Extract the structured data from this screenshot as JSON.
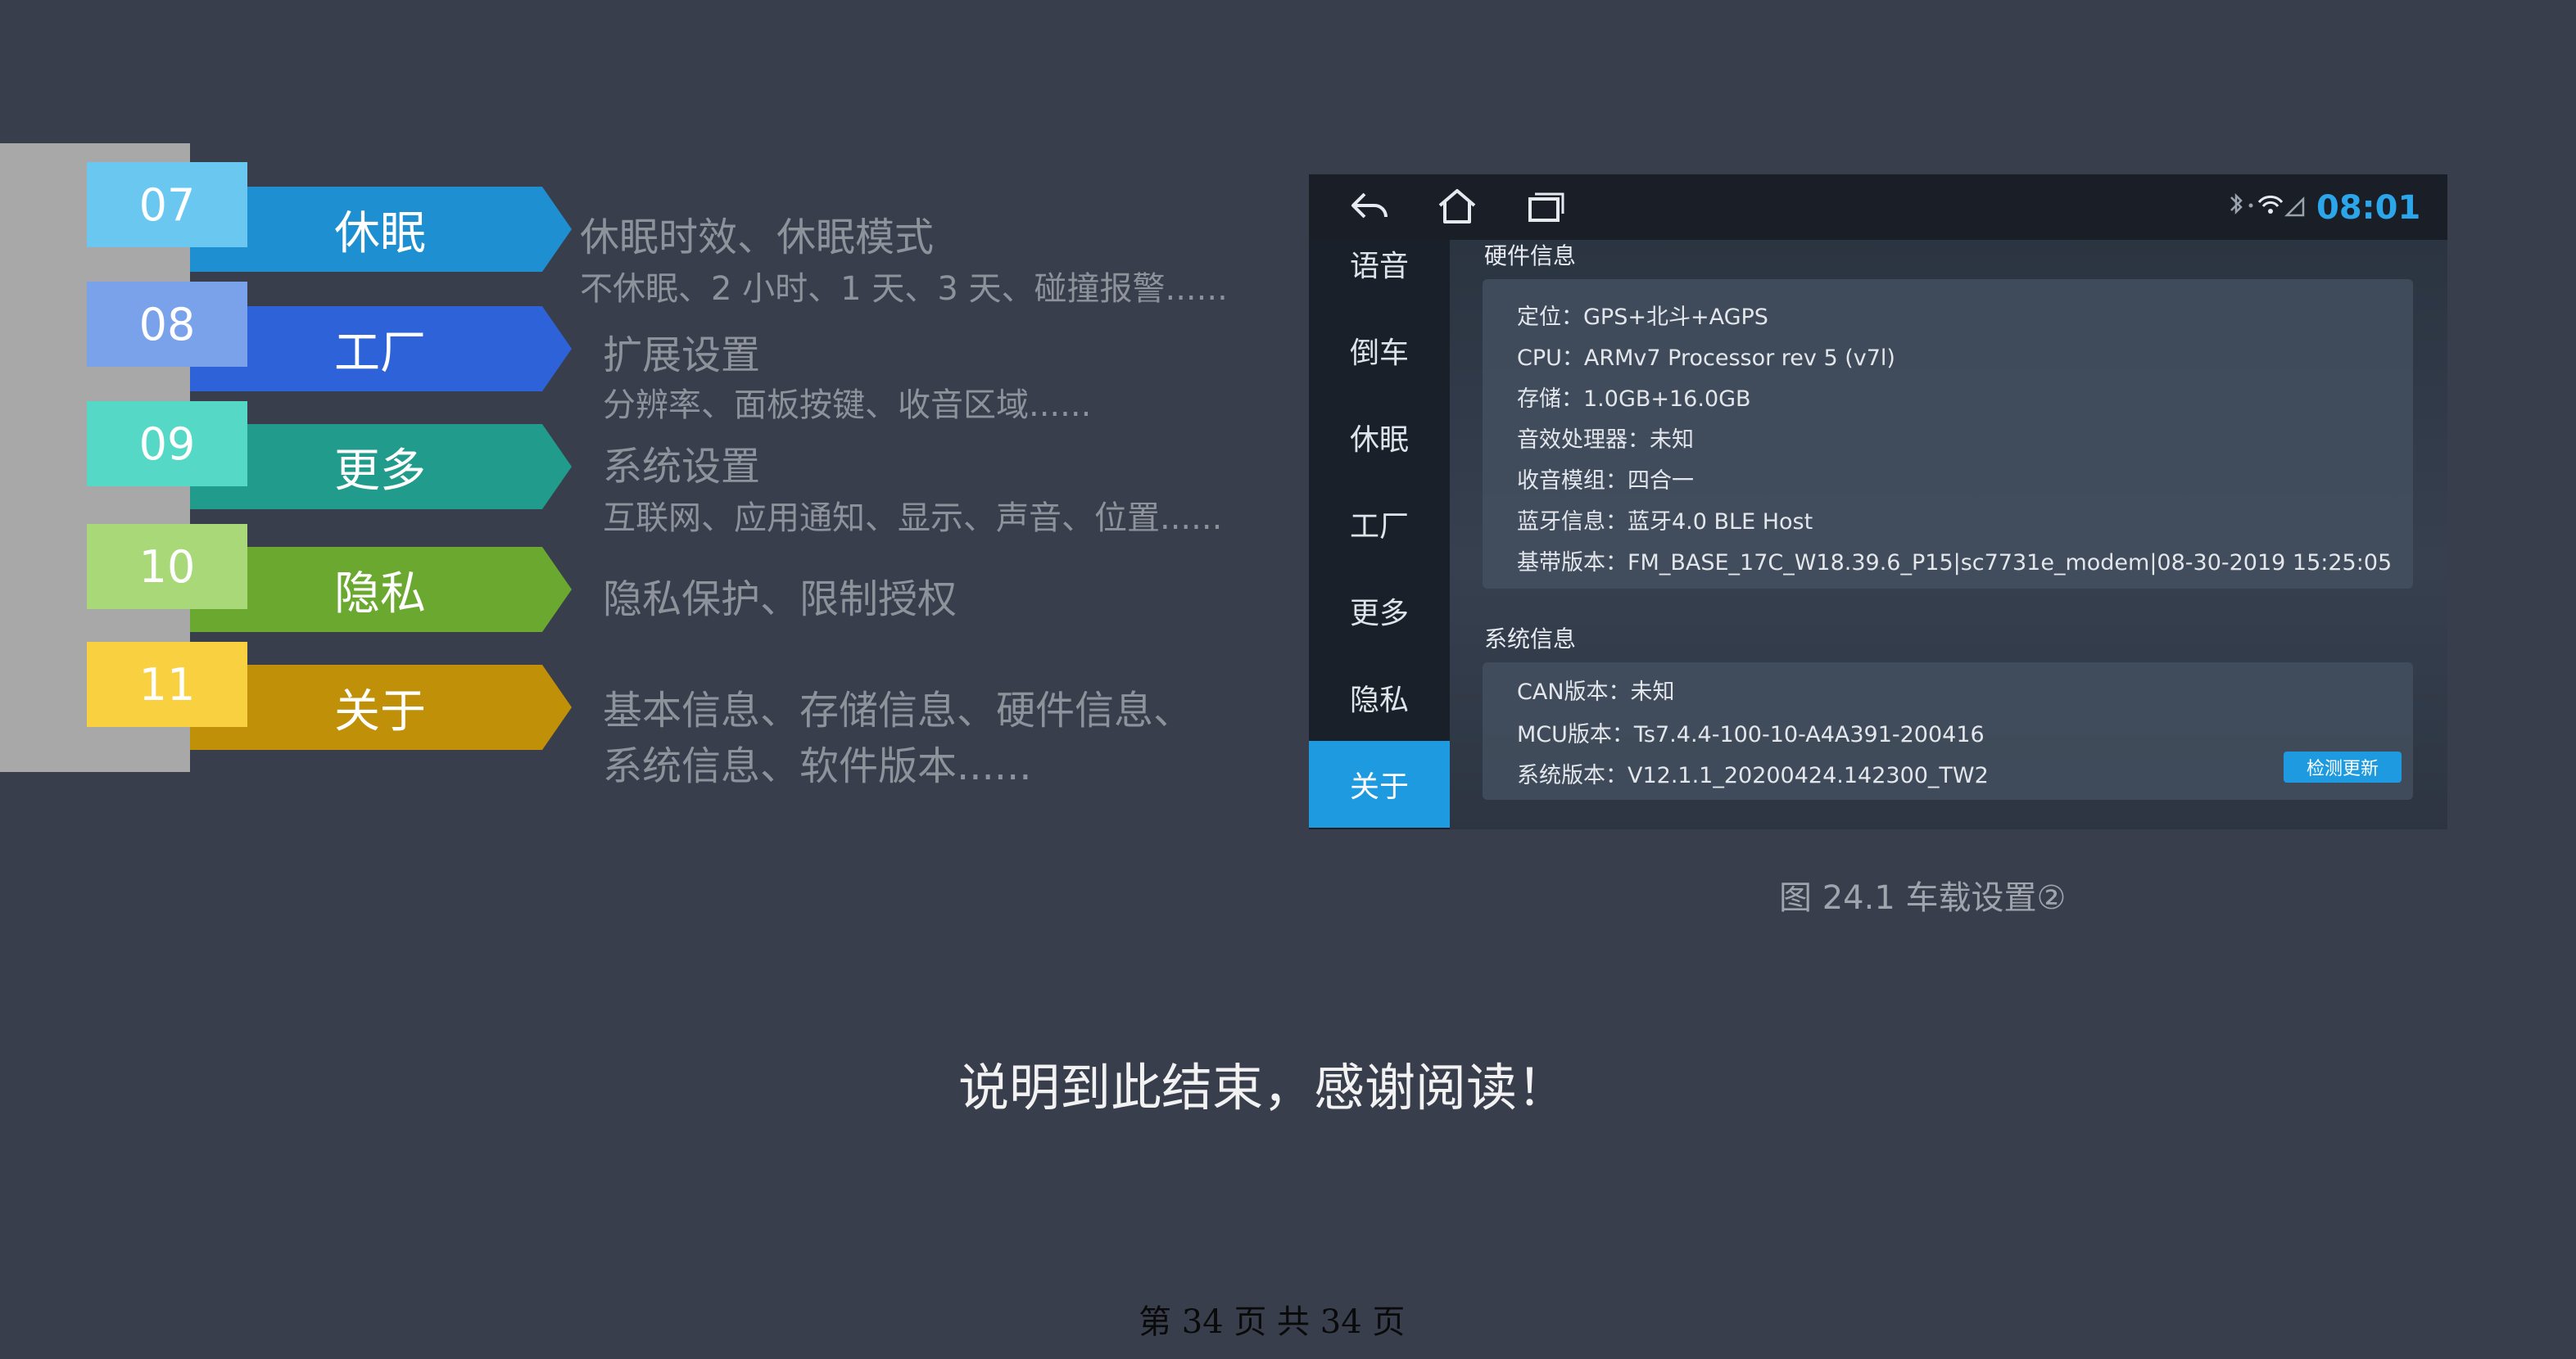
{
  "menu": [
    {
      "num": "07",
      "label": "休眠",
      "color_num": "#6ac8f0",
      "color_ribbon": "#1e8fd0",
      "title": "休眠时效、休眠模式",
      "sub": "不休眠、2 小时、1 天、3 天、碰撞报警......"
    },
    {
      "num": "08",
      "label": "工厂",
      "color_num": "#7aa2ea",
      "color_ribbon": "#2e62d8",
      "title": "扩展设置",
      "sub": "分辨率、面板按键、收音区域......"
    },
    {
      "num": "09",
      "label": "更多",
      "color_num": "#56d8c6",
      "color_ribbon": "#219b8c",
      "title": "系统设置",
      "sub": "互联网、应用通知、显示、声音、位置......"
    },
    {
      "num": "10",
      "label": "隐私",
      "color_num": "#a8d878",
      "color_ribbon": "#6aa830",
      "title": "隐私保护、限制授权",
      "sub": ""
    },
    {
      "num": "11",
      "label": "关于",
      "color_num": "#f8d040",
      "color_ribbon": "#c09008",
      "title": "基本信息、存储信息、硬件信息、",
      "sub": "系统信息、软件版本......"
    }
  ],
  "screen": {
    "time": "08:01",
    "sidebar": [
      "语音",
      "倒车",
      "休眠",
      "工厂",
      "更多",
      "隐私",
      "关于"
    ],
    "active_item": "关于",
    "hardware_title": "硬件信息",
    "hardware": [
      "定位：GPS+北斗+AGPS",
      "CPU：ARMv7 Processor rev 5 (v7l)",
      "存储：1.0GB+16.0GB",
      "音效处理器：未知",
      "收音模组：四合一",
      "蓝牙信息：蓝牙4.0 BLE Host",
      "基带版本：FM_BASE_17C_W18.39.6_P15|sc7731e_modem|08-30-2019 15:25:05"
    ],
    "system_title": "系统信息",
    "system": [
      "CAN版本：未知",
      "MCU版本：Ts7.4.4-100-10-A4A391-200416",
      "系统版本：V12.1.1_20200424.142300_TW2"
    ],
    "update_button": "检测更新",
    "accent": "#1e9be0"
  },
  "caption": "图 24.1  车载设置②",
  "closing": "说明到此结束，感谢阅读！",
  "footer": "第  34  页  共  34  页"
}
